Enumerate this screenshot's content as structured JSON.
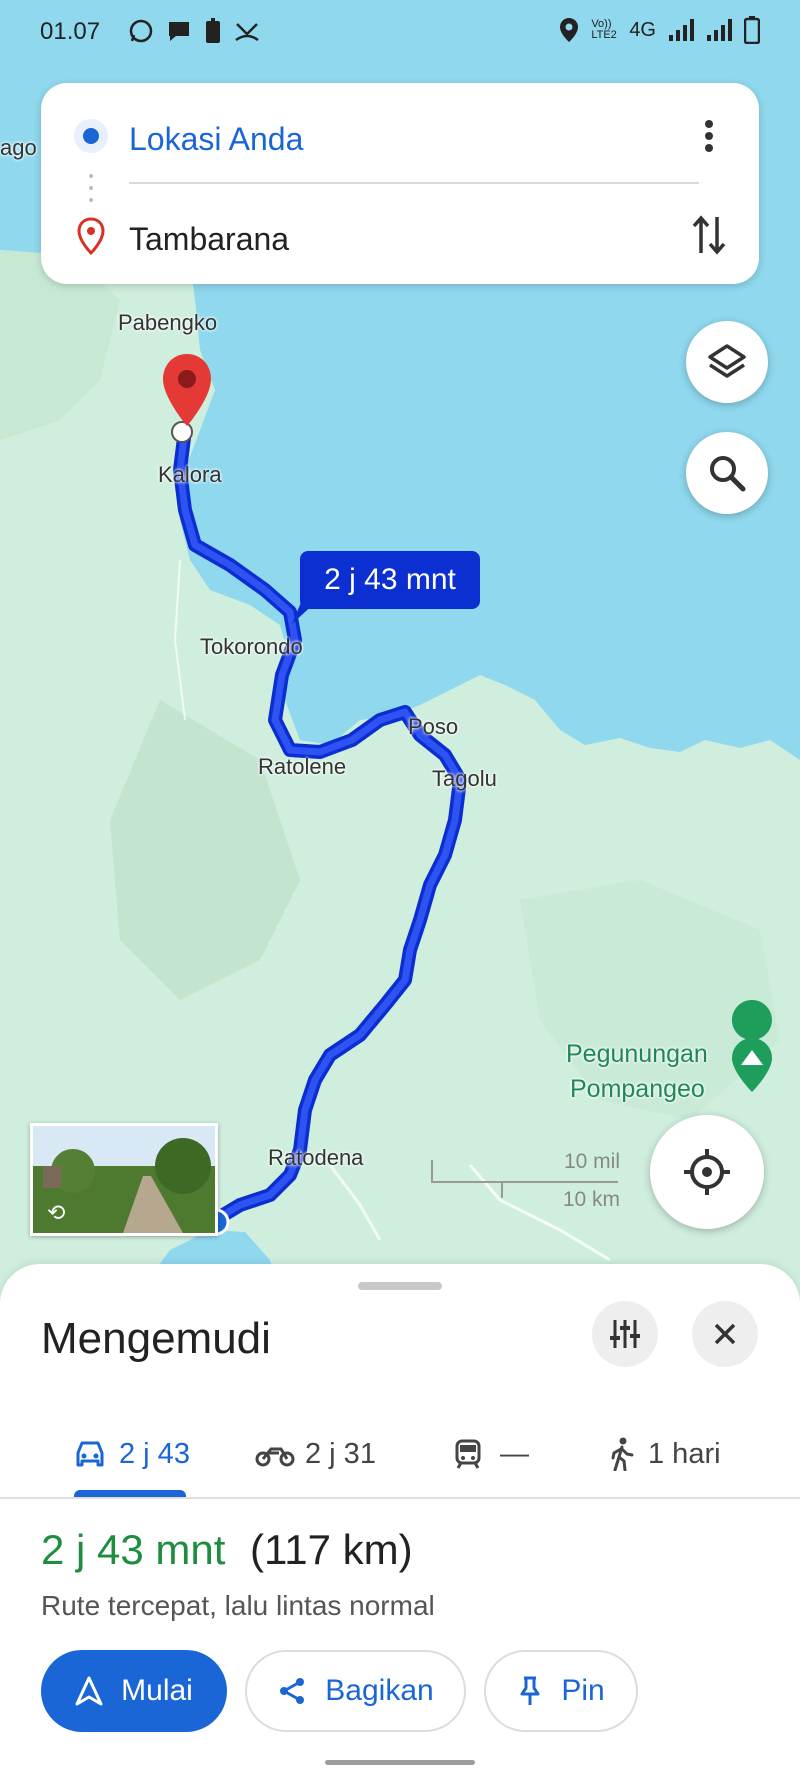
{
  "status_bar": {
    "time": "01.07",
    "network": "4G",
    "volte": "Vo)) LTE2"
  },
  "search": {
    "origin": "Lokasi Anda",
    "destination": "Tambarana"
  },
  "map": {
    "eta_label": "2 j 43 mnt",
    "places": [
      "ago",
      "Pabengko",
      "Kalora",
      "Tokorondo",
      "Ratolene",
      "Poso",
      "Tagolu",
      "Ratodena"
    ],
    "poi": {
      "line1": "Pegunungan",
      "line2": "Pompangeo"
    },
    "scale": {
      "imperial": "10 mil",
      "metric": "10 km"
    }
  },
  "sheet": {
    "title": "Mengemudi",
    "modes": [
      {
        "icon": "car-icon",
        "label": "2 j 43"
      },
      {
        "icon": "motorcycle-icon",
        "label": "2 j 31"
      },
      {
        "icon": "train-icon",
        "label": "—"
      },
      {
        "icon": "walk-icon",
        "label": "1 hari"
      }
    ],
    "duration": "2 j 43 mnt",
    "distance": "(117 km)",
    "route_description": "Rute tercepat, lalu lintas normal",
    "buttons": {
      "start": "Mulai",
      "share": "Bagikan",
      "pin": "Pin"
    }
  },
  "colors": {
    "water": "#8fd8ee",
    "land": "#cfeedd",
    "route": "#0b2fd1",
    "accent": "#1a66d6",
    "green_text": "#1e8e3e",
    "marker": "#e53935"
  }
}
